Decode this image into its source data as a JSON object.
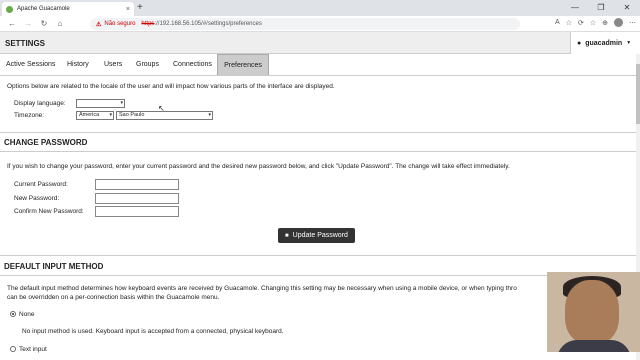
{
  "browser": {
    "tab_title": "Apache Guacamole",
    "tab_close": "×",
    "new_tab": "+",
    "window_controls": [
      "—",
      "❐",
      "✕"
    ],
    "nav": {
      "back": "←",
      "forward": "→",
      "reload": "↻",
      "home": "⌂"
    },
    "security_icon": "⚠",
    "security_text": "Não seguro",
    "url_scheme": "https",
    "url_rest": "://192.168.56.105/#/settings/preferences",
    "right_icons": [
      "A",
      "☆",
      "⟳",
      "☆",
      "⊕",
      "⋯"
    ]
  },
  "header": {
    "title": "SETTINGS",
    "user_icon": "👤",
    "username": "guacadmin",
    "caret": "▼"
  },
  "tabs": [
    {
      "label": "Active Sessions"
    },
    {
      "label": "History"
    },
    {
      "label": "Users"
    },
    {
      "label": "Groups"
    },
    {
      "label": "Connections"
    },
    {
      "label": "Preferences",
      "active": true
    }
  ],
  "locale": {
    "description": "Options below are related to the locale of the user and will impact how various parts of the interface are displayed.",
    "display_language_label": "Display language:",
    "display_language_value": "",
    "timezone_label": "Timezone:",
    "timezone_region": "America",
    "timezone_city": "Sao Paulo"
  },
  "change_password": {
    "title": "CHANGE PASSWORD",
    "description": "If you wish to change your password, enter your current password and the desired new password below, and click \"Update Password\". The change will take effect immediately.",
    "current_label": "Current Password:",
    "new_label": "New Password:",
    "confirm_label": "Confirm New Password:",
    "button_icon": "🔒",
    "button_label": "Update Password"
  },
  "input_method": {
    "title": "DEFAULT INPUT METHOD",
    "description_line1": "The default input method determines how keyboard events are received by Guacamole. Changing this setting may be necessary when using a mobile device, or when typing thro",
    "description_line2": "can be overridden on a per-connection basis within the Guacamole menu.",
    "option_none": "None",
    "option_none_desc": "No input method is used. Keyboard input is accepted from a connected, physical keyboard.",
    "option_text": "Text input"
  }
}
